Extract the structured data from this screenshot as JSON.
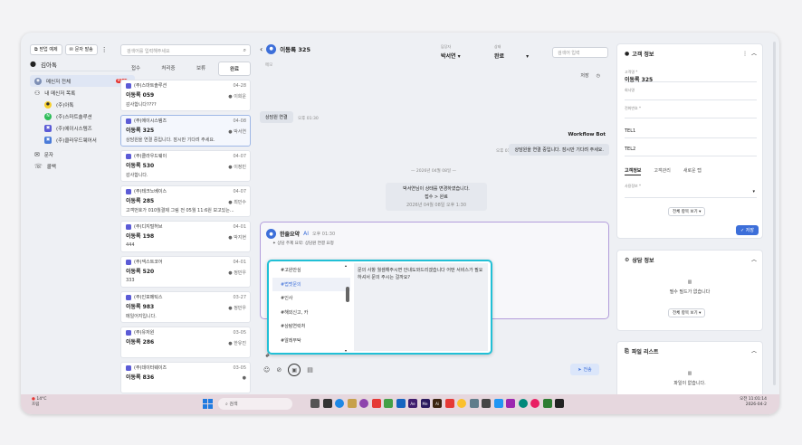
{
  "sidebar": {
    "top_buttons": [
      {
        "label": "받업 예제"
      },
      {
        "label": "문자 발송"
      }
    ],
    "user_name": "김아톡",
    "nav": [
      {
        "label": "메신저 전체",
        "badge": "99+",
        "active": true
      },
      {
        "label": "내 메신저 목록"
      },
      {
        "label": "(주)아톡",
        "sub": true
      },
      {
        "label": "(주)스마트솔루션",
        "sub": true
      },
      {
        "label": "(주)에이시스템즈",
        "sub": true
      },
      {
        "label": "(주)클라우드웨어서",
        "sub": true
      },
      {
        "label": "문자"
      },
      {
        "label": "콜백"
      }
    ]
  },
  "list": {
    "search_placeholder": "검색어를 입력해주세요",
    "tabs": [
      "접수",
      "처리중",
      "보류",
      "완료"
    ],
    "items": [
      {
        "company": "(주)스마트솔루션",
        "date": "04-28",
        "name": "이동록 059",
        "agent": "이희운",
        "msg": "감사합니다????"
      },
      {
        "company": "(주)에이시스템즈",
        "date": "04-08",
        "name": "이동록 325",
        "agent": "박서연",
        "msg": "상담원을 연결 중입니다. 잠시만 기다려 주세요."
      },
      {
        "company": "(주)클라우드웨이",
        "date": "04-07",
        "name": "이동록 530",
        "agent": "이정민",
        "msg": "감사합니다."
      },
      {
        "company": "(주)테크노베이스",
        "date": "04-07",
        "name": "이동록 285",
        "agent": "최민수",
        "msg": "고객번호가 010월결제 그림 전 05월 11:6원 보고있는..."
      },
      {
        "company": "(주)디지털허브",
        "date": "04-01",
        "name": "이동록 198",
        "agent": "박지현",
        "msg": "444"
      },
      {
        "company": "(주)넥스트코어",
        "date": "04-01",
        "name": "이동록 520",
        "agent": "정민우",
        "msg": "333"
      },
      {
        "company": "(주)인포메틱스",
        "date": "03-27",
        "name": "이동록 983",
        "agent": "정민우",
        "msg": "메일어지입니다."
      },
      {
        "company": "(주)유저원",
        "date": "03-05",
        "name": "이동록 286",
        "agent": "한유진",
        "msg": ""
      },
      {
        "company": "(주)데이터웨이즈",
        "date": "03-05",
        "name": "이동록 836",
        "agent": "",
        "msg": ""
      }
    ]
  },
  "chat": {
    "title": "이동록 325",
    "sub": "메모",
    "assignee_label": "담당자",
    "assignee": "박서연",
    "status_label": "상태",
    "status": "완료",
    "search_placeholder": "검색어 입력",
    "save": "저장",
    "sys_connect": "상담원 연결",
    "sys_connect_time": "오후 01:30",
    "bot_name": "Workflow Bot",
    "bot_msg": "상담원을 연결 중입니다. 잠시만 기다려 주세요.",
    "bot_time": "오후 01:30",
    "date_divider": "2026년 04월 08일",
    "note_line1": "박서연님이 상태를 변경하였습니다.",
    "note_line2": "접수 > 완료",
    "note_line3": "2026년 04월 08일 오후 1:30",
    "ai_title": "한줄요약",
    "ai_badge": "AI",
    "ai_time": "오후 01:30",
    "ai_sub": "상담 주제 요약: 상담원 연결 요청",
    "hash": "#",
    "send": "전송"
  },
  "popup": {
    "items": [
      "#고완안심",
      "#법맷문의",
      "#인사",
      "#해외신고, 카",
      "#상탐연락처",
      "#알레부탁"
    ],
    "highlight_index": 1,
    "preview": "문의 사항 월셈해주시면 안내도와드리겠습니다 어떤 서비스가 필요하셔서 문의 주시는 걸까요?"
  },
  "right": {
    "customer_title": "고객 정보",
    "fields": [
      {
        "label": "고객명 *",
        "value": "이동록 325"
      },
      {
        "label": "회사명",
        "value": ""
      },
      {
        "label": "전화번호 *",
        "value": ""
      },
      {
        "label": "",
        "value": "TEL1"
      },
      {
        "label": "",
        "value": "TEL2"
      }
    ],
    "tabs": [
      "고객정보",
      "고객관리",
      "새로운 탭"
    ],
    "select_label": "사용정보 *",
    "view_all": "전체 항목 보기",
    "save": "저장",
    "consult_title": "상담 정보",
    "consult_empty": "필수 필드가 없습니다",
    "file_title": "파일 리스트",
    "file_empty": "파일이 없습니다."
  },
  "taskbar": {
    "temp": "14°C",
    "weather": "흐림",
    "search": "검색",
    "time": "오전 11:01:14",
    "date": "2026-04-2"
  },
  "colors": {
    "accent": "#3d6fd9",
    "popup_border": "#21c0d6",
    "ai_border": "#b39ddb"
  }
}
